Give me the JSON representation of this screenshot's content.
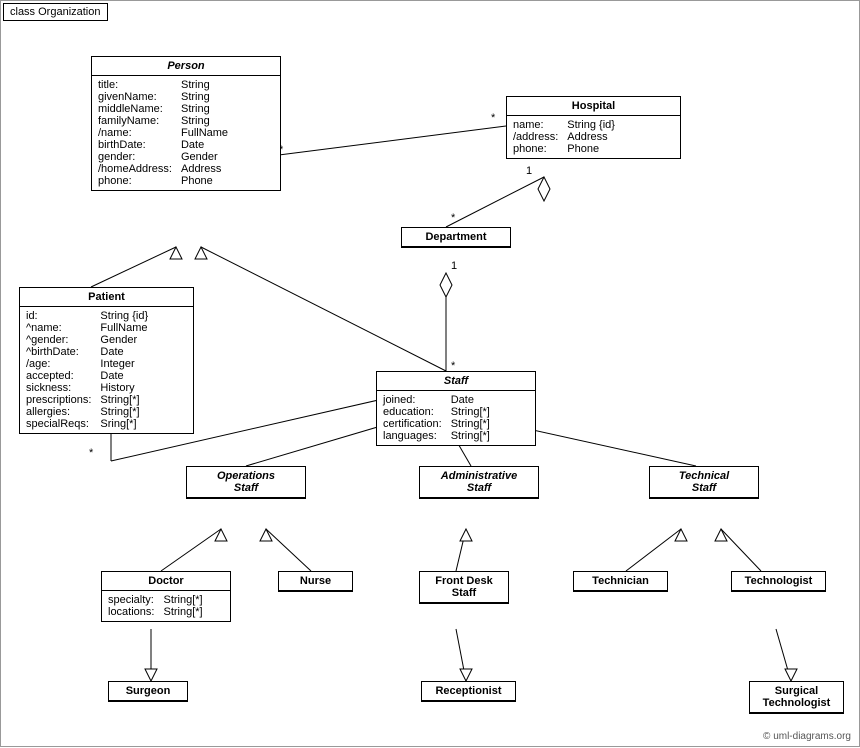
{
  "diagram": {
    "label": "class Organization",
    "copyright": "© uml-diagrams.org",
    "classes": {
      "person": {
        "name": "Person",
        "italic": true,
        "attrs": [
          [
            "title:",
            "String"
          ],
          [
            "givenName:",
            "String"
          ],
          [
            "middleName:",
            "String"
          ],
          [
            "familyName:",
            "String"
          ],
          [
            "/name:",
            "FullName"
          ],
          [
            "birthDate:",
            "Date"
          ],
          [
            "gender:",
            "Gender"
          ],
          [
            "/homeAddress:",
            "Address"
          ],
          [
            "phone:",
            "Phone"
          ]
        ]
      },
      "hospital": {
        "name": "Hospital",
        "attrs": [
          [
            "name:",
            "String {id}"
          ],
          [
            "/address:",
            "Address"
          ],
          [
            "phone:",
            "Phone"
          ]
        ]
      },
      "patient": {
        "name": "Patient",
        "attrs": [
          [
            "id:",
            "String {id}"
          ],
          [
            "^name:",
            "FullName"
          ],
          [
            "^gender:",
            "Gender"
          ],
          [
            "^birthDate:",
            "Date"
          ],
          [
            "/age:",
            "Integer"
          ],
          [
            "accepted:",
            "Date"
          ],
          [
            "sickness:",
            "History"
          ],
          [
            "prescriptions:",
            "String[*]"
          ],
          [
            "allergies:",
            "String[*]"
          ],
          [
            "specialReqs:",
            "Sring[*]"
          ]
        ]
      },
      "department": {
        "name": "Department",
        "attrs": []
      },
      "staff": {
        "name": "Staff",
        "italic": true,
        "attrs": [
          [
            "joined:",
            "Date"
          ],
          [
            "education:",
            "String[*]"
          ],
          [
            "certification:",
            "String[*]"
          ],
          [
            "languages:",
            "String[*]"
          ]
        ]
      },
      "operationsStaff": {
        "name": "Operations\nStaff",
        "italic": true,
        "attrs": []
      },
      "administrativeStaff": {
        "name": "Administrative\nStaff",
        "italic": true,
        "attrs": []
      },
      "technicalStaff": {
        "name": "Technical\nStaff",
        "italic": true,
        "attrs": []
      },
      "doctor": {
        "name": "Doctor",
        "attrs": [
          [
            "specialty:",
            "String[*]"
          ],
          [
            "locations:",
            "String[*]"
          ]
        ]
      },
      "nurse": {
        "name": "Nurse",
        "attrs": []
      },
      "frontDeskStaff": {
        "name": "Front Desk\nStaff",
        "attrs": []
      },
      "technician": {
        "name": "Technician",
        "attrs": []
      },
      "technologist": {
        "name": "Technologist",
        "attrs": []
      },
      "surgeon": {
        "name": "Surgeon",
        "attrs": []
      },
      "receptionist": {
        "name": "Receptionist",
        "attrs": []
      },
      "surgicalTechnologist": {
        "name": "Surgical\nTechnologist",
        "attrs": []
      }
    }
  }
}
